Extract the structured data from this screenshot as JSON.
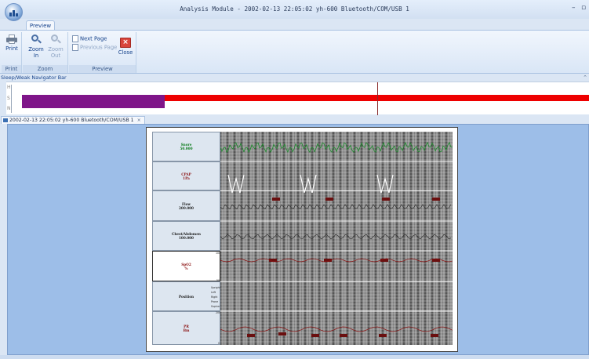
{
  "window": {
    "title": "Analysis Module - 2002-02-13 22:05:02  yh-600  Bluetooth/COM/USB  1",
    "minimize_label": "–",
    "restore_label": "▫"
  },
  "ribbon": {
    "tab_label": "Preview",
    "groups": {
      "print": {
        "label": "Print",
        "print_button": "Print"
      },
      "zoom": {
        "label": "Zoom",
        "zoom_in": "Zoom In",
        "zoom_out": "Zoom Out"
      },
      "preview": {
        "label": "Preview",
        "next_page": "Next Page",
        "previous_page": "Previous Page",
        "close": "Close"
      }
    }
  },
  "navigator": {
    "label": "Sleep/Weak Navigator Bar",
    "pin_glyph": "⌃",
    "ticks": [
      "H",
      "S",
      "N"
    ]
  },
  "document_tab": {
    "label": "2002-02-13 22:05:02  yh-600  Bluetooth/COM/USB  1",
    "close_glyph": "×"
  },
  "report": {
    "channels": [
      {
        "name": "Snore",
        "unit": "50.000",
        "color": "#0a7a1a"
      },
      {
        "name": "CPAP",
        "unit": "1Pa",
        "color": "#8a1010"
      },
      {
        "name": "Flow",
        "unit": "200.000",
        "color": "#1a1a1a"
      },
      {
        "name": "Chest/Abdomen",
        "unit": "100.000",
        "color": "#1a1a1a"
      },
      {
        "name": "SpO2",
        "unit": "%",
        "color": "#8a1010"
      },
      {
        "name": "Position",
        "unit": "",
        "color": "#1a1a1a"
      },
      {
        "name": "PR",
        "unit": "Bm",
        "color": "#8a1010"
      }
    ],
    "position_labels": [
      "Upright",
      "Left",
      "Right",
      "Prone",
      "Supine"
    ],
    "scale_labels": {
      "spo2_top": "100",
      "spo2_bottom": "50",
      "pr_top": "200",
      "pr_bottom": "0"
    }
  },
  "colors": {
    "wake_segment": "#7f1589",
    "sleep_segment": "#ee0000",
    "workspace": "#9dbee8"
  }
}
